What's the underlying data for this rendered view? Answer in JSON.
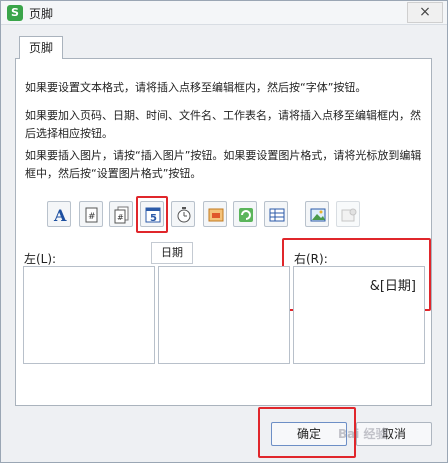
{
  "window": {
    "title": "页脚",
    "app_icon_glyph": "S",
    "close_glyph": "×"
  },
  "tab": {
    "label": "页脚"
  },
  "instructions": [
    "如果要设置文本格式，请将插入点移至编辑框内，然后按“字体”按钮。",
    "如果要加入页码、日期、时间、文件名、工作表名，请将插入点移至编辑框内，然后选择相应按钮。",
    "如果要插入图片，请按“插入图片”按钮。如果要设置图片格式，请将光标放到编辑框中，然后按“设置图片格式”按钮。"
  ],
  "toolbar": {
    "buttons": [
      {
        "icon": "font-icon",
        "glyph": "A"
      },
      {
        "icon": "page-number-icon",
        "glyph": "#"
      },
      {
        "icon": "total-pages-icon",
        "glyph": "#"
      },
      {
        "icon": "date-icon",
        "glyph": "5"
      },
      {
        "icon": "time-icon"
      },
      {
        "icon": "file-path-icon"
      },
      {
        "icon": "file-name-icon"
      },
      {
        "icon": "sheet-name-icon"
      },
      {
        "icon": "insert-picture-icon"
      },
      {
        "icon": "format-picture-icon"
      }
    ]
  },
  "tooltip": {
    "label": "日期"
  },
  "sections": {
    "left_label": "左(L):",
    "right_label": "右(R):",
    "right_value": "&[日期]"
  },
  "buttons": {
    "ok": "确定",
    "cancel": "取消"
  },
  "watermark": "Bai 经验",
  "colors": {
    "highlight": "#e0262b",
    "app_icon": "#3aa54a"
  }
}
